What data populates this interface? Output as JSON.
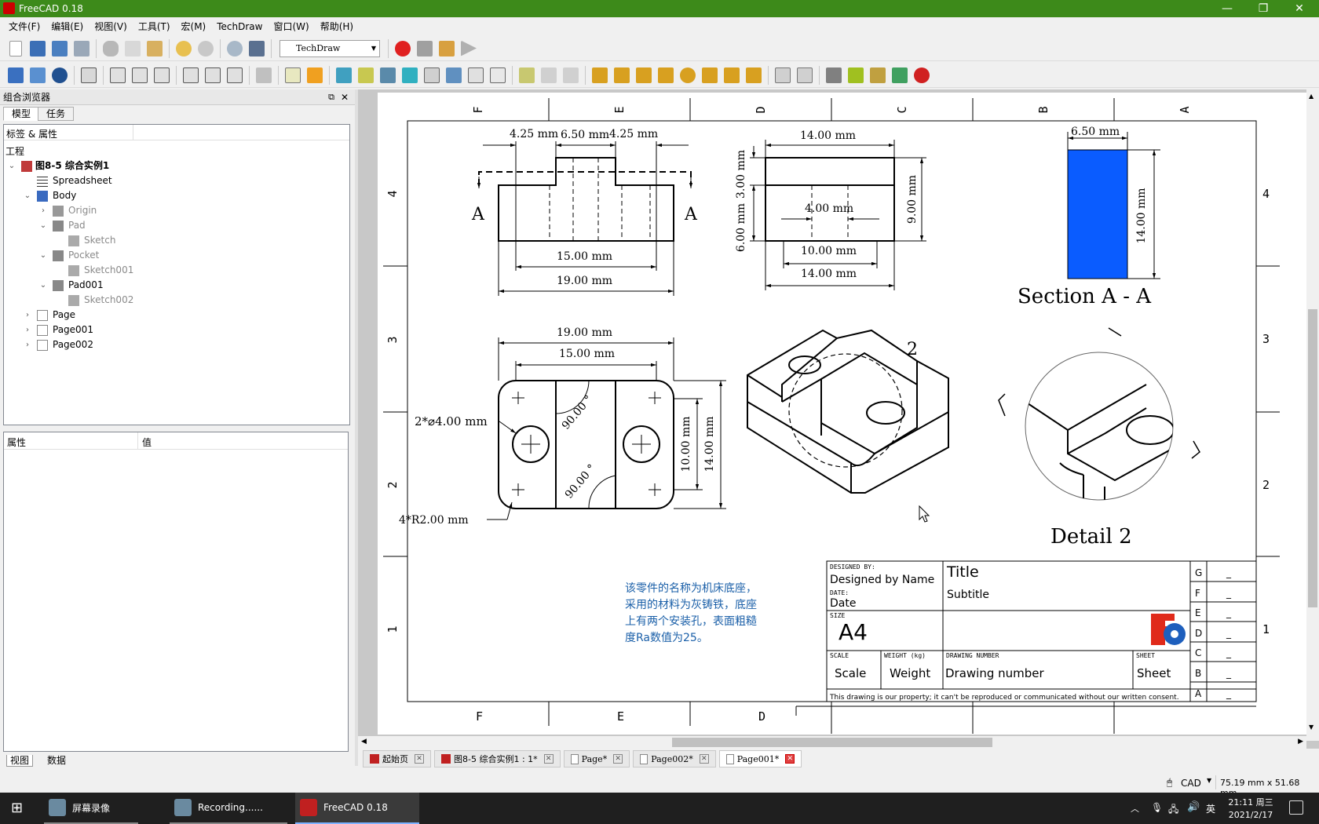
{
  "app": {
    "title": "FreeCAD 0.18"
  },
  "window_controls": {
    "minimize": "—",
    "maximize": "❐",
    "close": "✕"
  },
  "menu": [
    "文件(F)",
    "编辑(E)",
    "视图(V)",
    "工具(T)",
    "宏(M)",
    "TechDraw",
    "窗口(W)",
    "帮助(H)"
  ],
  "workbench": {
    "selected": "TechDraw"
  },
  "left_panel": {
    "title": "组合浏览器",
    "tabs": [
      "模型",
      "任务"
    ],
    "tree_header": "标签 & 属性",
    "tree_group": "工程",
    "tree": [
      {
        "label": "图8-5 综合实例1",
        "bold": true,
        "dim": false,
        "icon": "document-icon"
      },
      {
        "label": "Spreadsheet",
        "dim": false,
        "icon": "spreadsheet-icon"
      },
      {
        "label": "Body",
        "dim": false,
        "icon": "body-icon"
      },
      {
        "label": "Origin",
        "dim": true,
        "icon": "origin-icon"
      },
      {
        "label": "Pad",
        "dim": true,
        "icon": "pad-icon"
      },
      {
        "label": "Sketch",
        "dim": true,
        "icon": "sketch-icon"
      },
      {
        "label": "Pocket",
        "dim": true,
        "icon": "pocket-icon"
      },
      {
        "label": "Sketch001",
        "dim": true,
        "icon": "sketch-icon"
      },
      {
        "label": "Pad001",
        "dim": false,
        "icon": "pad-icon"
      },
      {
        "label": "Sketch002",
        "dim": true,
        "icon": "sketch-icon"
      },
      {
        "label": "Page",
        "dim": false,
        "icon": "page-icon"
      },
      {
        "label": "Page001",
        "dim": false,
        "icon": "page-icon"
      },
      {
        "label": "Page002",
        "dim": false,
        "icon": "page-icon"
      }
    ],
    "props_headers": [
      "属性",
      "值"
    ],
    "bottom_tabs": [
      "视图",
      "数据"
    ]
  },
  "drawing": {
    "col_labels": [
      "F",
      "E",
      "D",
      "C",
      "B",
      "A"
    ],
    "bottom_col_labels": [
      "F",
      "E",
      "D"
    ],
    "row_labels": [
      "4",
      "3",
      "2",
      "1"
    ],
    "front_view": {
      "d1": "4.25 mm",
      "d2": "6.50 mm",
      "d3": "4.25 mm",
      "d4": "15.00 mm",
      "d5": "19.00 mm",
      "cut_left": "A",
      "cut_right": "A"
    },
    "side_view": {
      "top": "14.00 mm",
      "left1": "3.00 mm",
      "left2": "6.00 mm",
      "mid": "4.00 mm",
      "right": "9.00 mm",
      "b1": "10.00 mm",
      "b2": "14.00 mm"
    },
    "section_view": {
      "width": "6.50 mm",
      "height": "14.00 mm",
      "label": "Section A - A",
      "fill": "#0a5cff"
    },
    "top_view": {
      "d1": "19.00 mm",
      "d2": "15.00 mm",
      "holes": "2*⌀4.00 mm",
      "radius": "4*R2.00 mm",
      "ang1": "90.00 °",
      "ang2": "90.00 °",
      "h1": "10.00 mm",
      "h2": "14.00 mm"
    },
    "iso_label": "2",
    "detail_label": "Detail 2",
    "note": [
      "该零件的名称为机床底座，",
      "采用的材料为灰铸铁，底座",
      "上有两个安装孔，表面粗糙",
      "度Ra数值为25。"
    ],
    "title_block": {
      "designed_by_lbl": "DESIGNED BY:",
      "designed_by": "Designed by Name",
      "date_lbl": "DATE:",
      "date": "Date",
      "title": "Title",
      "subtitle": "Subtitle",
      "size_lbl": "SIZE",
      "size": "A4",
      "scale_lbl": "SCALE",
      "scale": "Scale",
      "weight_lbl": "WEIGHT (kg)",
      "weight": "Weight",
      "dn_lbl": "DRAWING NUMBER",
      "dn": "Drawing number",
      "sheet_lbl": "SHEET",
      "sheet": "Sheet",
      "footer": "This drawing is our property; it can't be reproduced or communicated without our written consent.",
      "revs": [
        "G",
        "F",
        "E",
        "D",
        "C",
        "B",
        "A"
      ],
      "rev_val": "_"
    }
  },
  "doc_tabs": [
    {
      "label": "起始页",
      "active": false
    },
    {
      "label": "图8-5 综合实例1 : 1*",
      "active": false
    },
    {
      "label": "Page*",
      "active": false
    },
    {
      "label": "Page002*",
      "active": false
    },
    {
      "label": "Page001*",
      "active": true
    }
  ],
  "status": {
    "nav": "CAD",
    "dims": "75.19 mm x 51.68 mm"
  },
  "taskbar": {
    "items": [
      "屏幕录像",
      "Recording......",
      "FreeCAD 0.18"
    ],
    "ime": "英",
    "time": "21:11 周三",
    "date": "2021/2/17"
  }
}
